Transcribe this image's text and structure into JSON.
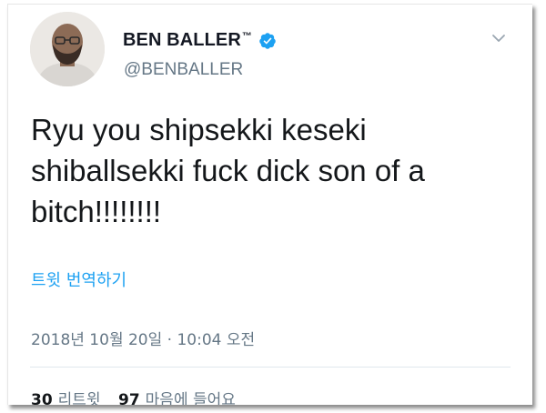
{
  "user": {
    "display_name": "BEN BALLER",
    "trademark": "™",
    "handle": "@BENBALLER",
    "verified": true
  },
  "tweet": {
    "text": "Ryu you shipsekki keseki\nshiballsekki fuck dick son of a\nbitch!!!!!!!!",
    "translate_label": "트윗 번역하기",
    "timestamp": "2018년 10월 20일 · 10:04 오전"
  },
  "stats": {
    "retweets_count": "30",
    "retweets_label": "리트윗",
    "likes_count": "97",
    "likes_label": "마음에 들어요"
  },
  "colors": {
    "accent": "#1da1f2",
    "text": "#14171a",
    "muted": "#657786"
  },
  "icons": {
    "verified": "verified-badge-icon",
    "menu": "chevron-down-icon"
  }
}
